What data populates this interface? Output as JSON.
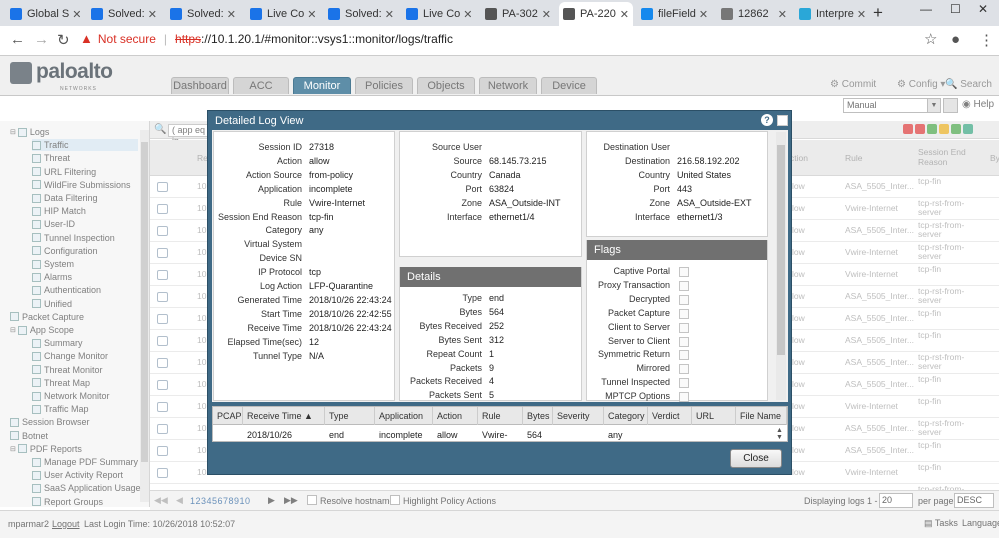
{
  "browser": {
    "tabs": [
      {
        "label": "Global S",
        "color": "#1a73e8"
      },
      {
        "label": "Solved:",
        "color": "#1a73e8"
      },
      {
        "label": "Solved:",
        "color": "#1a73e8"
      },
      {
        "label": "Live Co",
        "color": "#1a73e8"
      },
      {
        "label": "Solved:",
        "color": "#1a73e8"
      },
      {
        "label": "Live Co",
        "color": "#1a73e8"
      },
      {
        "label": "PA-302",
        "color": "#555555"
      },
      {
        "label": "PA-220",
        "color": "#555555"
      },
      {
        "label": "fileField",
        "color": "#1589ee"
      },
      {
        "label": "12862",
        "color": "#777777"
      },
      {
        "label": "Interpre",
        "color": "#2aa7d8"
      }
    ],
    "new_tab": "+",
    "window_controls": [
      "—",
      "☐",
      "✕"
    ],
    "not_secure": "Not secure",
    "url_scheme": "https",
    "url_rest": "://10.1.20.1/#monitor::vsys1::monitor/logs/traffic",
    "star": "☆",
    "profile": "●",
    "menu": "⋮"
  },
  "app": {
    "logo_name": "paloalto",
    "logo_sub": "NETWORKS",
    "nav_tabs": [
      "Dashboard",
      "ACC",
      "Monitor",
      "Policies",
      "Objects",
      "Network",
      "Device"
    ],
    "active_tab": "Monitor",
    "commit": "Commit",
    "config": "Config",
    "search": "Search",
    "manual": "Manual",
    "help": "Help"
  },
  "sidebar": {
    "items": [
      {
        "label": "Logs",
        "level": 0,
        "toggle": "▣"
      },
      {
        "label": "Traffic",
        "level": 1,
        "selected": true
      },
      {
        "label": "Threat",
        "level": 1
      },
      {
        "label": "URL Filtering",
        "level": 1
      },
      {
        "label": "WildFire Submissions",
        "level": 1
      },
      {
        "label": "Data Filtering",
        "level": 1
      },
      {
        "label": "HIP Match",
        "level": 1
      },
      {
        "label": "User-ID",
        "level": 1
      },
      {
        "label": "Tunnel Inspection",
        "level": 1
      },
      {
        "label": "Configuration",
        "level": 1
      },
      {
        "label": "System",
        "level": 1
      },
      {
        "label": "Alarms",
        "level": 1
      },
      {
        "label": "Authentication",
        "level": 1
      },
      {
        "label": "Unified",
        "level": 1
      },
      {
        "label": "Packet Capture",
        "level": 0
      },
      {
        "label": "App Scope",
        "level": 0,
        "toggle": "▣"
      },
      {
        "label": "Summary",
        "level": 1
      },
      {
        "label": "Change Monitor",
        "level": 1
      },
      {
        "label": "Threat Monitor",
        "level": 1
      },
      {
        "label": "Threat Map",
        "level": 1
      },
      {
        "label": "Network Monitor",
        "level": 1
      },
      {
        "label": "Traffic Map",
        "level": 1
      },
      {
        "label": "Session Browser",
        "level": 0
      },
      {
        "label": "Botnet",
        "level": 0
      },
      {
        "label": "PDF Reports",
        "level": 0,
        "toggle": "▣"
      },
      {
        "label": "Manage PDF Summary",
        "level": 1
      },
      {
        "label": "User Activity Report",
        "level": 1
      },
      {
        "label": "SaaS Application Usage",
        "level": 1
      },
      {
        "label": "Report Groups",
        "level": 1
      }
    ]
  },
  "bg_table": {
    "filter_text": "( app eq in",
    "headers": {
      "receive_time": "Re",
      "action": "ction",
      "rule": "Rule",
      "session_end_reason": "Session End Reason",
      "bytes": "By"
    },
    "rows": [
      {
        "recv": "10",
        "action": "low",
        "rule": "ASA_5505_Inter...",
        "reason": "tcp-fin"
      },
      {
        "recv": "10",
        "action": "low",
        "rule": "Vwire-Internet",
        "reason": "tcp-rst-from-server"
      },
      {
        "recv": "10",
        "action": "low",
        "rule": "ASA_5505_Inter...",
        "reason": "tcp-rst-from-server"
      },
      {
        "recv": "10",
        "action": "low",
        "rule": "Vwire-Internet",
        "reason": "tcp-rst-from-server"
      },
      {
        "recv": "10",
        "action": "low",
        "rule": "Vwire-Internet",
        "reason": "tcp-fin"
      },
      {
        "recv": "10",
        "action": "low",
        "rule": "ASA_5505_Inter...",
        "reason": "tcp-rst-from-server"
      },
      {
        "recv": "10",
        "action": "low",
        "rule": "ASA_5505_Inter...",
        "reason": "tcp-fin"
      },
      {
        "recv": "10",
        "action": "low",
        "rule": "ASA_5505_Inter...",
        "reason": "tcp-fin"
      },
      {
        "recv": "10",
        "action": "low",
        "rule": "ASA_5505_Inter...",
        "reason": "tcp-rst-from-server"
      },
      {
        "recv": "10",
        "action": "low",
        "rule": "ASA_5505_Inter...",
        "reason": "tcp-fin"
      },
      {
        "recv": "10",
        "action": "low",
        "rule": "Vwire-Internet",
        "reason": "tcp-fin"
      },
      {
        "recv": "10",
        "action": "low",
        "rule": "ASA_5505_Inter...",
        "reason": "tcp-rst-from-server"
      },
      {
        "recv": "10",
        "action": "low",
        "rule": "ASA_5505_Inter...",
        "reason": "tcp-fin"
      },
      {
        "recv": "10",
        "action": "low",
        "rule": "Vwire-Internet",
        "reason": "tcp-fin"
      },
      {
        "recv": "10",
        "action": "low",
        "rule": "ASA_5505_Inter...",
        "reason": "tcp-rst-from-server"
      },
      {
        "recv": "10",
        "action": "low",
        "rule": "Vwire-Internet",
        "reason": "tcp-rst-from-server"
      }
    ]
  },
  "pager": {
    "pages": "12345678910",
    "resolve_hostname": "Resolve hostname",
    "highlight_policy": "Highlight Policy Actions",
    "displaying": "Displaying logs 1 - 20",
    "per_page_value": "20",
    "per_page": "per page",
    "order": "DESC"
  },
  "status": {
    "user": "mparmar2",
    "logout": "Logout",
    "last_login": "Last Login Time: 10/26/2018 10:52:07",
    "tasks": "Tasks",
    "language": "Language"
  },
  "modal": {
    "title": "Detailed Log View",
    "general": [
      {
        "k": "Session ID",
        "v": "27318"
      },
      {
        "k": "Action",
        "v": "allow"
      },
      {
        "k": "Action Source",
        "v": "from-policy"
      },
      {
        "k": "Application",
        "v": "incomplete"
      },
      {
        "k": "Rule",
        "v": "Vwire-Internet"
      },
      {
        "k": "Session End Reason",
        "v": "tcp-fin"
      },
      {
        "k": "Category",
        "v": "any"
      },
      {
        "k": "Virtual System",
        "v": ""
      },
      {
        "k": "Device SN",
        "v": ""
      },
      {
        "k": "IP Protocol",
        "v": "tcp"
      },
      {
        "k": "Log Action",
        "v": "LFP-Quarantine"
      },
      {
        "k": "Generated Time",
        "v": "2018/10/26 22:43:24"
      },
      {
        "k": "Start Time",
        "v": "2018/10/26 22:42:55"
      },
      {
        "k": "Receive Time",
        "v": "2018/10/26 22:43:24"
      },
      {
        "k": "Elapsed Time(sec)",
        "v": "12"
      },
      {
        "k": "Tunnel Type",
        "v": "N/A"
      }
    ],
    "source": [
      {
        "k": "Source User",
        "v": ""
      },
      {
        "k": "Source",
        "v": "68.145.73.215"
      },
      {
        "k": "Country",
        "v": "Canada"
      },
      {
        "k": "Port",
        "v": "63824"
      },
      {
        "k": "Zone",
        "v": "ASA_Outside-INT"
      },
      {
        "k": "Interface",
        "v": "ethernet1/4"
      }
    ],
    "destination": [
      {
        "k": "Destination User",
        "v": ""
      },
      {
        "k": "Destination",
        "v": "216.58.192.202"
      },
      {
        "k": "Country",
        "v": "United States"
      },
      {
        "k": "Port",
        "v": "443"
      },
      {
        "k": "Zone",
        "v": "ASA_Outside-EXT"
      },
      {
        "k": "Interface",
        "v": "ethernet1/3"
      }
    ],
    "details_title": "Details",
    "details": [
      {
        "k": "Type",
        "v": "end"
      },
      {
        "k": "Bytes",
        "v": "564"
      },
      {
        "k": "Bytes Received",
        "v": "252"
      },
      {
        "k": "Bytes Sent",
        "v": "312"
      },
      {
        "k": "Repeat Count",
        "v": "1"
      },
      {
        "k": "Packets",
        "v": "9"
      },
      {
        "k": "Packets Received",
        "v": "4"
      },
      {
        "k": "Packets Sent",
        "v": "5"
      }
    ],
    "flags_title": "Flags",
    "flags": [
      "Captive Portal",
      "Proxy Transaction",
      "Decrypted",
      "Packet Capture",
      "Client to Server",
      "Server to Client",
      "Symmetric Return",
      "Mirrored",
      "Tunnel Inspected",
      "MPTCP Options"
    ],
    "table_headers": [
      "PCAP",
      "Receive Time",
      "Type",
      "Application",
      "Action",
      "Rule",
      "Bytes",
      "Severity",
      "Category",
      "Verdict",
      "URL",
      "File Name"
    ],
    "table_row": {
      "receive_time": "2018/10/26",
      "type": "end",
      "application": "incomplete",
      "action": "allow",
      "rule": "Vwire-",
      "bytes": "564",
      "category": "any"
    },
    "close": "Close"
  },
  "colors": {
    "modal_frame": "#3f6a86",
    "panel_header": "#707070",
    "active_nav": "#5e8ea8"
  }
}
